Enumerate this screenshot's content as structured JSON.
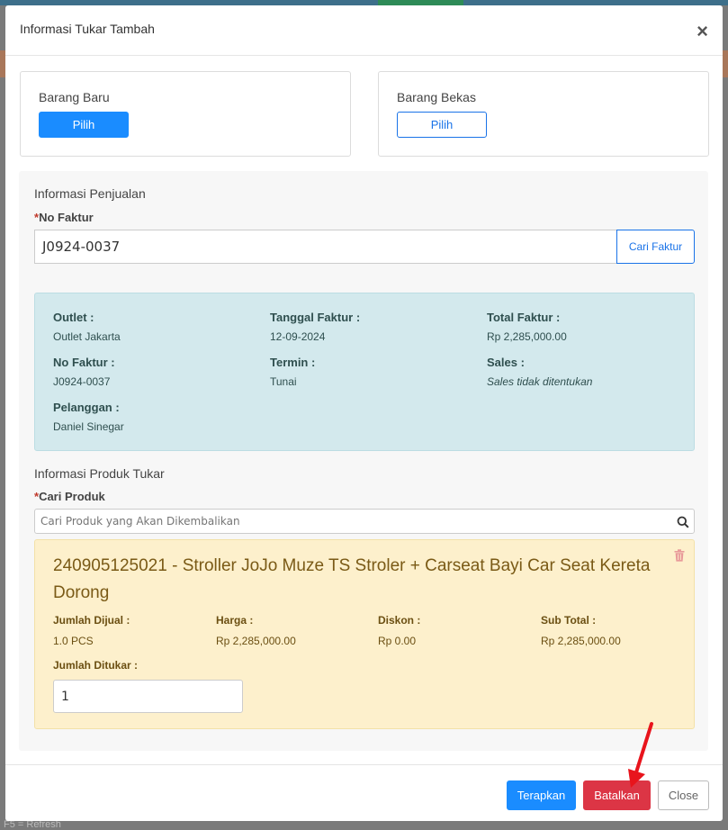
{
  "background": {
    "footer_hint": "F5 = Refresh"
  },
  "modal": {
    "title": "Informasi Tukar Tambah",
    "close_icon": "×"
  },
  "barang_baru": {
    "label": "Barang Baru",
    "button": "Pilih"
  },
  "barang_bekas": {
    "label": "Barang Bekas",
    "button": "Pilih"
  },
  "penjualan": {
    "section_title": "Informasi Penjualan",
    "no_faktur_required": "*",
    "no_faktur_label": "No Faktur",
    "no_faktur_value": "J0924-0037",
    "cari_faktur_button": "Cari Faktur"
  },
  "invoice": {
    "outlet_label": "Outlet :",
    "outlet_value": "Outlet Jakarta",
    "tanggal_label": "Tanggal Faktur :",
    "tanggal_value": "12-09-2024",
    "total_label": "Total Faktur :",
    "total_value": "Rp 2,285,000.00",
    "no_faktur_label": "No Faktur :",
    "no_faktur_value": "J0924-0037",
    "termin_label": "Termin :",
    "termin_value": "Tunai",
    "sales_label": "Sales :",
    "sales_value": "Sales tidak ditentukan",
    "pelanggan_label": "Pelanggan :",
    "pelanggan_value": "Daniel Sinegar"
  },
  "produk_tukar": {
    "section_title": "Informasi Produk Tukar",
    "cari_required": "*",
    "cari_label": "Cari Produk",
    "search_placeholder": "Cari Produk yang Akan Dikembalikan"
  },
  "product": {
    "title": "240905125021 - Stroller JoJo Muze TS Stroler + Carseat Bayi Car Seat Kereta Dorong",
    "jumlah_dijual_label": "Jumlah Dijual :",
    "jumlah_dijual_value": "1.0 PCS",
    "harga_label": "Harga :",
    "harga_value": "Rp 2,285,000.00",
    "diskon_label": "Diskon :",
    "diskon_value": "Rp 0.00",
    "subtotal_label": "Sub Total :",
    "subtotal_value": "Rp 2,285,000.00",
    "jumlah_ditukar_label": "Jumlah Ditukar :",
    "jumlah_ditukar_value": "1"
  },
  "footer": {
    "terapkan": "Terapkan",
    "batalkan": "Batalkan",
    "close": "Close"
  },
  "colors": {
    "primary": "#1a8cff",
    "danger": "#dc3545",
    "info_bg": "#d3e9ed",
    "warning_bg": "#fdf0cc",
    "annotation_arrow": "#e8141c"
  }
}
